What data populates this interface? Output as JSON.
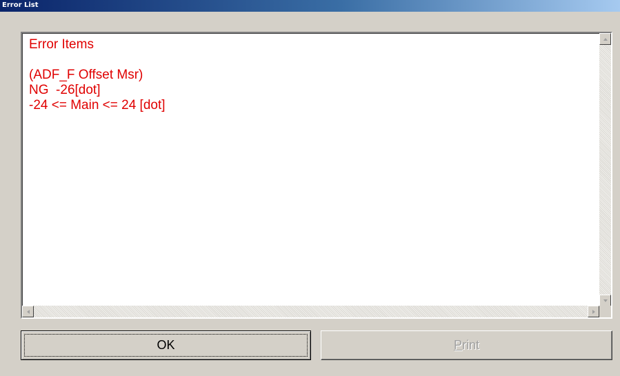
{
  "window": {
    "title": "Error List"
  },
  "error_text": {
    "lines": [
      "Error Items",
      "",
      "(ADF_F Offset Msr)",
      "NG  -26[dot]",
      "-24 <= Main <= 24 [dot]"
    ],
    "color": "#e00000"
  },
  "buttons": {
    "ok_label": "OK",
    "print_label_accel": "P",
    "print_label_rest": "rint",
    "print_enabled": false
  },
  "icons": {
    "scroll_up": "arrow-up-icon",
    "scroll_down": "arrow-down-icon",
    "scroll_left": "arrow-left-icon",
    "scroll_right": "arrow-right-icon"
  }
}
